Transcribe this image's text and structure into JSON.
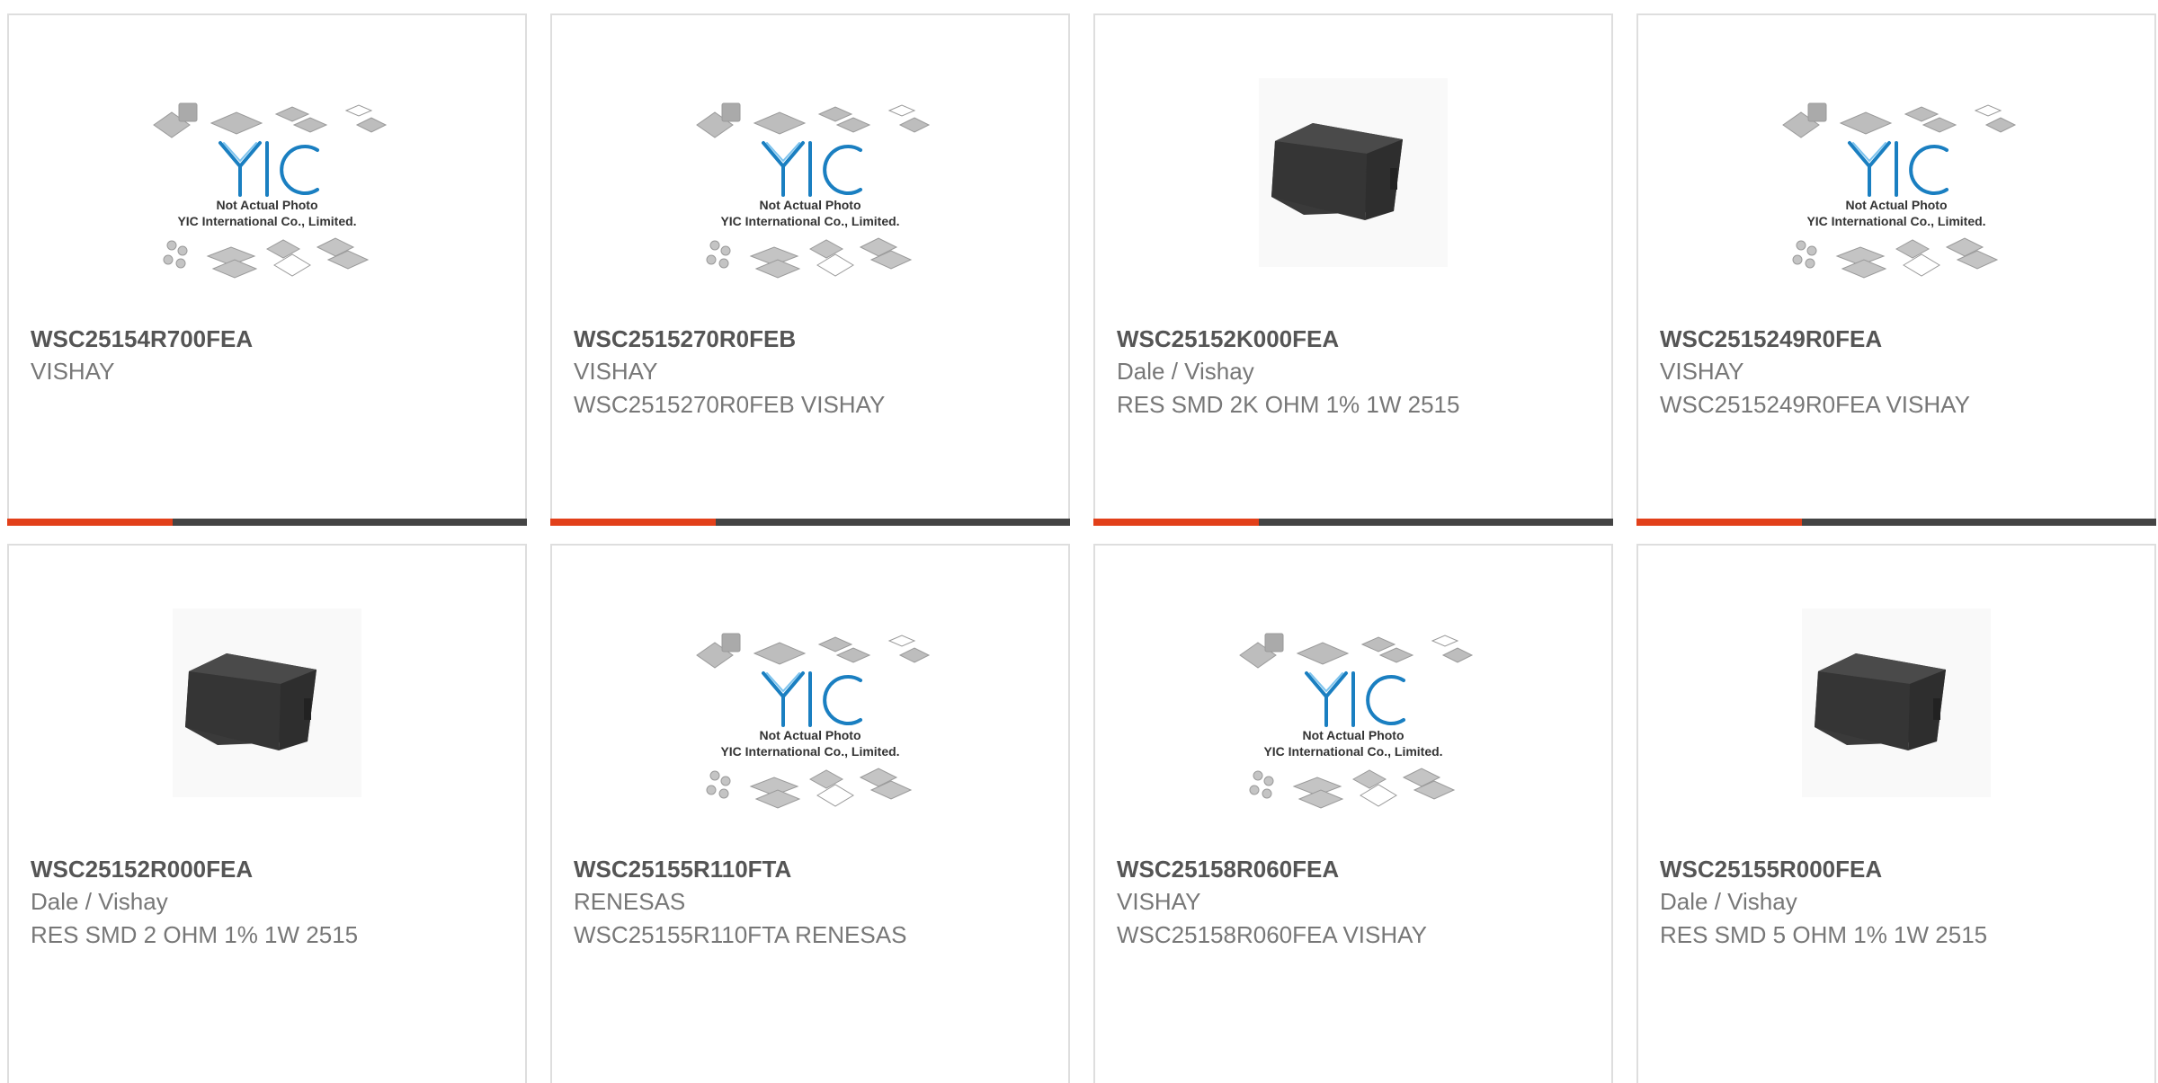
{
  "products": [
    {
      "part_number": "WSC25154R700FEA",
      "manufacturer": "VISHAY",
      "description": "",
      "image": "placeholder"
    },
    {
      "part_number": "WSC2515270R0FEB",
      "manufacturer": "VISHAY",
      "description": "WSC2515270R0FEB VISHAY",
      "image": "placeholder"
    },
    {
      "part_number": "WSC25152K000FEA",
      "manufacturer": "Dale / Vishay",
      "description": "RES SMD 2K OHM 1% 1W 2515",
      "image": "resistor-photo"
    },
    {
      "part_number": "WSC2515249R0FEA",
      "manufacturer": "VISHAY",
      "description": "WSC2515249R0FEA VISHAY",
      "image": "placeholder"
    },
    {
      "part_number": "WSC25152R000FEA",
      "manufacturer": "Dale / Vishay",
      "description": "RES SMD 2 OHM 1% 1W 2515",
      "image": "resistor-photo"
    },
    {
      "part_number": "WSC25155R110FTA",
      "manufacturer": "RENESAS",
      "description": "WSC25155R110FTA RENESAS",
      "image": "placeholder"
    },
    {
      "part_number": "WSC25158R060FEA",
      "manufacturer": "VISHAY",
      "description": "WSC25158R060FEA VISHAY",
      "image": "placeholder"
    },
    {
      "part_number": "WSC25155R000FEA",
      "manufacturer": "Dale / Vishay",
      "description": "RES SMD 5 OHM 1% 1W 2515",
      "image": "resistor-photo"
    }
  ],
  "placeholder": {
    "logo": "YIC",
    "line1": "Not Actual Photo",
    "line2": "YIC International Co., Limited."
  },
  "colors": {
    "accent": "#e2401a",
    "bar": "#444444",
    "logo": "#1a7fc1"
  }
}
